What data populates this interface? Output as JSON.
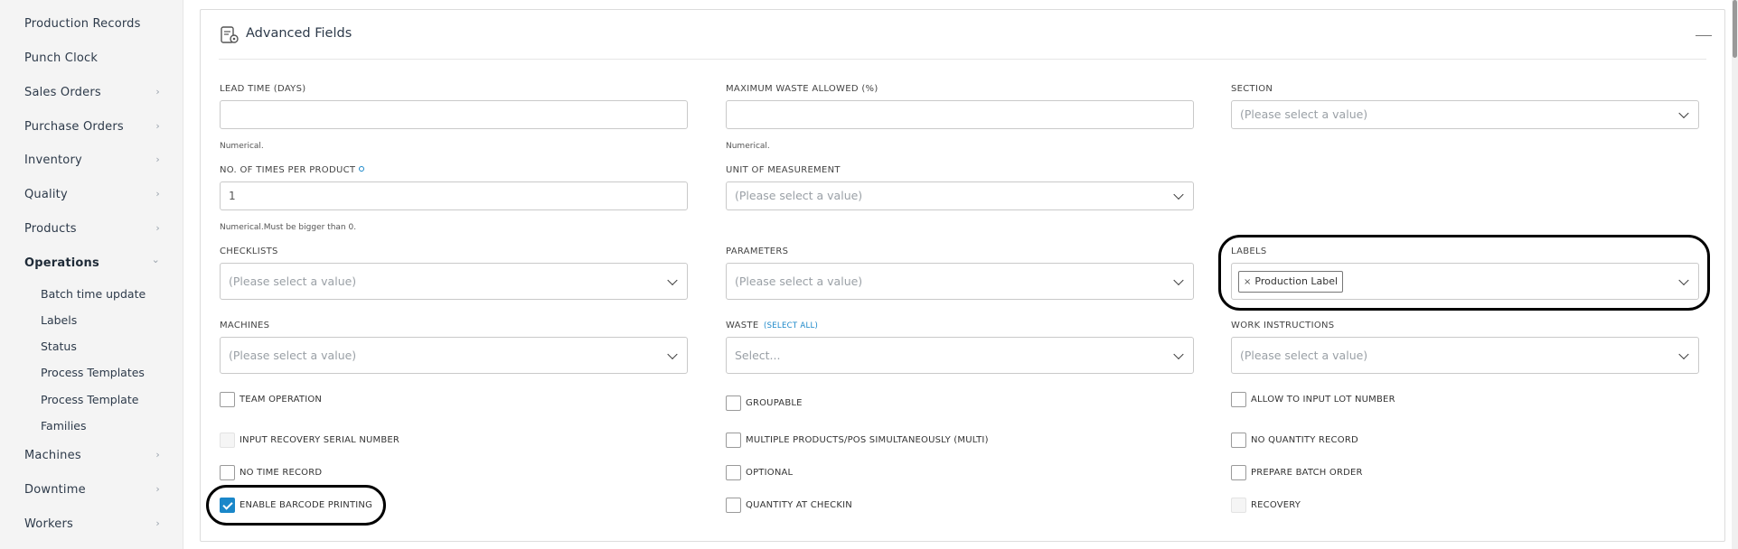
{
  "sidebar": {
    "items": [
      {
        "label": "Production Records",
        "chevron": false
      },
      {
        "label": "Punch Clock",
        "chevron": false
      },
      {
        "label": "Sales Orders",
        "chevron": true
      },
      {
        "label": "Purchase Orders",
        "chevron": true
      },
      {
        "label": "Inventory",
        "chevron": true
      },
      {
        "label": "Quality",
        "chevron": true
      },
      {
        "label": "Products",
        "chevron": true
      },
      {
        "label": "Operations",
        "chevron": true,
        "expanded": true
      },
      {
        "label": "Machines",
        "chevron": true
      },
      {
        "label": "Downtime",
        "chevron": true
      },
      {
        "label": "Workers",
        "chevron": true
      }
    ],
    "sub_items": [
      "Batch time update",
      "Labels",
      "Status",
      "Process Templates",
      "Process Template",
      "Families"
    ],
    "chevron_right": "›",
    "chevron_down": "⌄"
  },
  "panel": {
    "title": "Advanced Fields",
    "icon": "settings-document-icon"
  },
  "fields": {
    "lead_time": {
      "label": "LEAD TIME (DAYS)",
      "value": "",
      "hint": "Numerical."
    },
    "max_waste": {
      "label": "MAXIMUM WASTE ALLOWED (%)",
      "value": "",
      "hint": "Numerical."
    },
    "section": {
      "label": "SECTION",
      "placeholder": "(Please select a value)"
    },
    "times_per_product": {
      "label": "NO. OF TIMES PER PRODUCT",
      "value": "1",
      "hint": "Numerical.Must be bigger than 0."
    },
    "unit": {
      "label": "UNIT OF MEASUREMENT",
      "placeholder": "(Please select a value)"
    },
    "checklists": {
      "label": "CHECKLISTS",
      "placeholder": "(Please select a value)"
    },
    "parameters": {
      "label": "PARAMETERS",
      "placeholder": "(Please select a value)"
    },
    "labels": {
      "label": "LABELS",
      "tag": "Production Label",
      "tag_remove": "×"
    },
    "machines": {
      "label": "MACHINES",
      "placeholder": "(Please select a value)"
    },
    "waste": {
      "label": "WASTE",
      "select_all": "(SELECT ALL)",
      "placeholder": "Select..."
    },
    "work_instructions": {
      "label": "WORK INSTRUCTIONS",
      "placeholder": "(Please select a value)"
    }
  },
  "checkboxes": {
    "team_operation": {
      "label": "TEAM OPERATION",
      "checked": false
    },
    "groupable": {
      "label": "GROUPABLE",
      "checked": false
    },
    "allow_lot": {
      "label": "ALLOW TO INPUT LOT NUMBER",
      "checked": false
    },
    "input_recovery": {
      "label": "INPUT RECOVERY SERIAL NUMBER",
      "checked": false,
      "disabled": true
    },
    "multiple_products": {
      "label": "MULTIPLE PRODUCTS/POS SIMULTANEOUSLY (MULTI)",
      "checked": false
    },
    "no_quantity": {
      "label": "NO QUANTITY RECORD",
      "checked": false
    },
    "no_time": {
      "label": "NO TIME RECORD",
      "checked": false
    },
    "optional": {
      "label": "OPTIONAL",
      "checked": false
    },
    "prepare_batch": {
      "label": "PREPARE BATCH ORDER",
      "checked": false
    },
    "barcode": {
      "label": "ENABLE BARCODE PRINTING",
      "checked": true
    },
    "quantity_checkin": {
      "label": "QUANTITY AT CHECKIN",
      "checked": false
    },
    "recovery": {
      "label": "RECOVERY",
      "checked": false,
      "disabled": true
    }
  },
  "colors": {
    "accent": "#1a87c9",
    "highlight": "#000000"
  }
}
